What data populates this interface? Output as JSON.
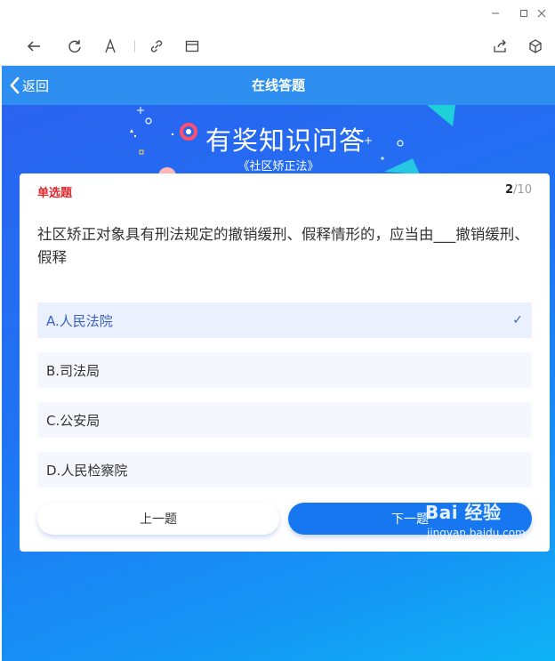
{
  "window": {
    "controls": [
      "minimize-icon",
      "maximize-icon",
      "close-icon"
    ]
  },
  "toolbar": {
    "icons": [
      "back-arrow-icon",
      "refresh-icon",
      "text-size-icon",
      "link-icon",
      "window-icon",
      "share-icon",
      "cube-icon"
    ]
  },
  "header": {
    "back_label": "返回",
    "title": "在线答题"
  },
  "banner": {
    "title": "有奖知识问答",
    "subtitle": "《社区矫正法》"
  },
  "question": {
    "type": "单选题",
    "current": "2",
    "total": "/10",
    "text": "社区矫正对象具有刑法规定的撤销缓刑、假释情形的，应当由___撤销缓刑、假释",
    "options": [
      {
        "label": "A.人民法院",
        "selected": true
      },
      {
        "label": "B.司法局",
        "selected": false
      },
      {
        "label": "C.公安局",
        "selected": false
      },
      {
        "label": "D.人民检察院",
        "selected": false
      }
    ],
    "check_glyph": "✓"
  },
  "navigation": {
    "prev_label": "上一题",
    "next_label": "下一题"
  },
  "watermark": {
    "main": "Bai 经验",
    "sub": "jingyan.baidu.com"
  },
  "colors": {
    "header_bg": "#2f8ff0",
    "accent": "#1677f0",
    "question_type": "#e0262d",
    "selected_text": "#3b62c4"
  }
}
